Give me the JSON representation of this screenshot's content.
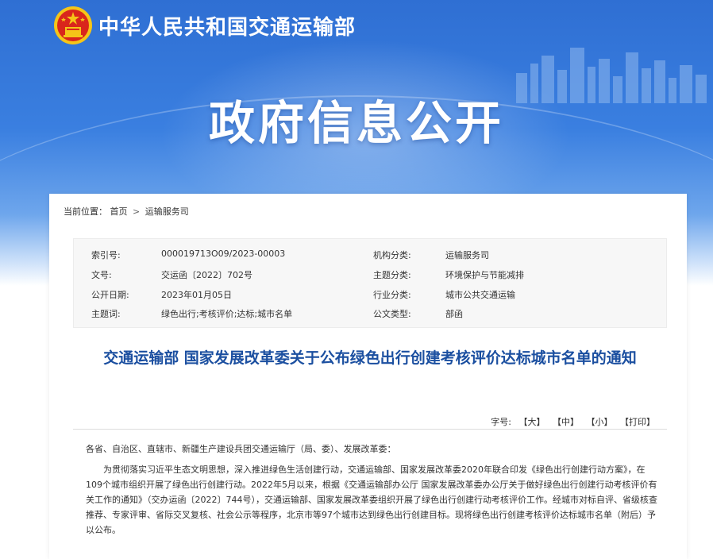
{
  "header": {
    "ministry_name": "中华人民共和国交通运输部",
    "hero_title": "政府信息公开"
  },
  "breadcrumb": {
    "label": "当前位置：",
    "home": "首页",
    "separator": ">",
    "current": "运输服务司"
  },
  "meta": [
    {
      "label1": "索引号:",
      "value1": "000019713O09/2023-00003",
      "label2": "机构分类:",
      "value2": "运输服务司"
    },
    {
      "label1": "文号:",
      "value1": "交运函〔2022〕702号",
      "label2": "主题分类:",
      "value2": "环境保护与节能减排"
    },
    {
      "label1": "公开日期:",
      "value1": "2023年01月05日",
      "label2": "行业分类:",
      "value2": "城市公共交通运输"
    },
    {
      "label1": "主题词:",
      "value1": "绿色出行;考核评价;达标;城市名单",
      "label2": "公文类型:",
      "value2": "部函"
    }
  ],
  "document": {
    "title": "交通运输部 国家发展改革委关于公布绿色出行创建考核评价达标城市名单的通知"
  },
  "toolbar": {
    "label": "字号:",
    "large": "【大】",
    "medium": "【中】",
    "small": "【小】",
    "print": "【打印】"
  },
  "body": {
    "salutation": "各省、自治区、直辖市、新疆生产建设兵团交通运输厅（局、委）、发展改革委：",
    "paragraph1": "为贯彻落实习近平生态文明思想，深入推进绿色生活创建行动，交通运输部、国家发展改革委2020年联合印发《绿色出行创建行动方案》，在109个城市组织开展了绿色出行创建行动。2022年5月以来，根据《交通运输部办公厅 国家发展改革委办公厅关于做好绿色出行创建行动考核评价有关工作的通知》（交办运函〔2022〕744号），交通运输部、国家发展改革委组织开展了绿色出行创建行动考核评价工作。经城市对标自评、省级核查推荐、专家评审、省际交叉复核、社会公示等程序，北京市等97个城市达到绿色出行创建目标。现将绿色出行创建考核评价达标城市名单（附后）予以公布。"
  },
  "colors": {
    "banner_blue": "#2f6fd3",
    "title_blue": "#1b4fa0",
    "emblem_red": "#d9261c",
    "emblem_gold": "#f5c518"
  }
}
